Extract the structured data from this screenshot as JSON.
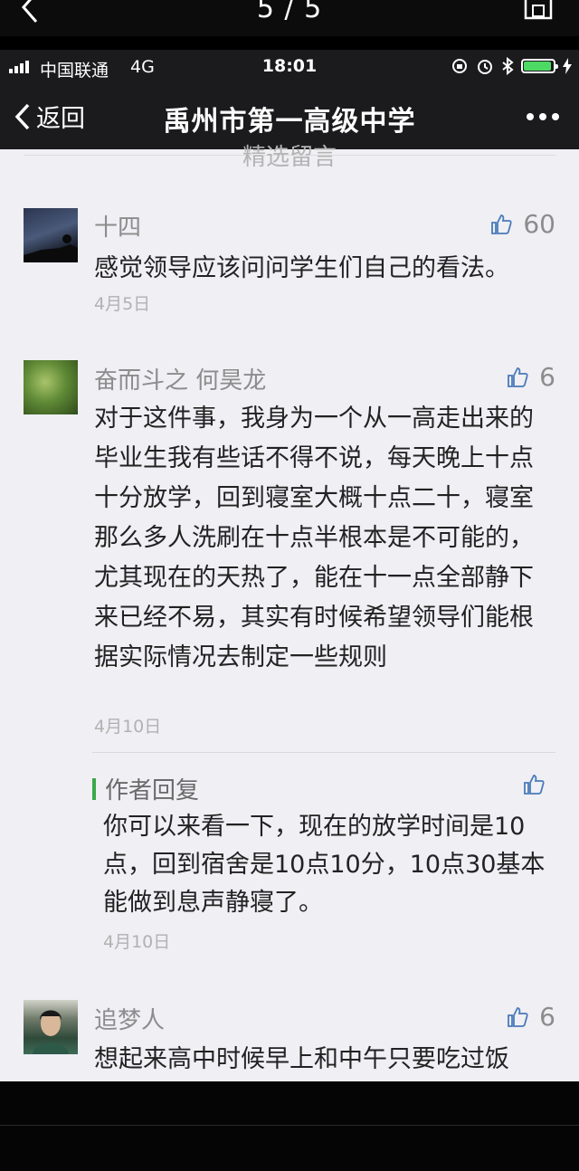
{
  "viewer": {
    "counter": "5 / 5"
  },
  "status_bar": {
    "carrier": "中国联通",
    "network": "4G",
    "time": "18:01"
  },
  "nav": {
    "back_label": "返回",
    "title": "禹州市第一高级中学"
  },
  "section_title": "精选留言",
  "comments": [
    {
      "name": "十四",
      "likes": "60",
      "content": "感觉领导应该问问学生们自己的看法。",
      "date": "4月5日"
    },
    {
      "name": "奋而斗之 何昊龙",
      "likes": "6",
      "content": "对于这件事，我身为一个从一高走出来的毕业生我有些话不得不说，每天晚上十点十分放学，回到寝室大概十点二十，寝室那么多人洗刷在十点半根本是不可能的，尤其现在的天热了，能在十一点全部静下来已经不易，其实有时候希望领导们能根据实际情况去制定一些规则",
      "date": "4月10日",
      "reply": {
        "label": "作者回复",
        "content": "你可以来看一下，现在的放学时间是10点，回到宿舍是10点10分，10点30基本能做到息声静寝了。",
        "date": "4月10日"
      }
    },
    {
      "name": "追梦人",
      "likes": "6",
      "content": "想起来高中时候早上和中午只要吃过饭"
    }
  ],
  "colors": {
    "accent_green": "#3aa94a",
    "battery_green": "#4cd964",
    "page_background": "#efeff4",
    "nav_background": "#1b1b1d"
  },
  "icons": [
    "back-arrow-icon",
    "save-icon",
    "signal-bars-icon",
    "orientation-lock-icon",
    "alarm-icon",
    "bluetooth-icon",
    "battery-icon",
    "charging-icon",
    "thumbs-up-icon",
    "more-dots-icon"
  ]
}
